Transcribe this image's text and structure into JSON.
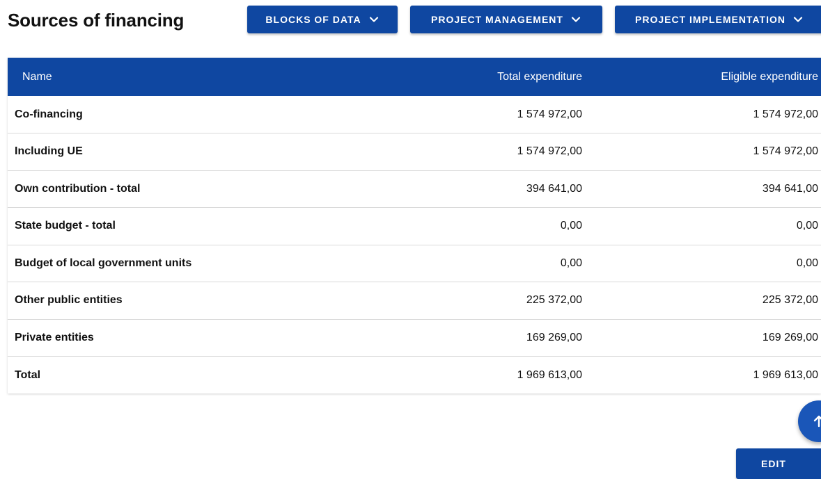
{
  "header": {
    "title": "Sources of financing",
    "nav_buttons": [
      {
        "label": "BLOCKS OF DATA",
        "icon": "chevron-down-icon"
      },
      {
        "label": "PROJECT MANAGEMENT",
        "icon": "chevron-down-icon"
      },
      {
        "label": "PROJECT IMPLEMENTATION",
        "icon": "chevron-down-icon"
      }
    ]
  },
  "table": {
    "columns": [
      "Name",
      "Total expenditure",
      "Eligible expenditure"
    ],
    "rows": [
      {
        "name": "Co-financing",
        "total": "1 574 972,00",
        "eligible": "1 574 972,00"
      },
      {
        "name": "Including UE",
        "total": "1 574 972,00",
        "eligible": "1 574 972,00"
      },
      {
        "name": "Own contribution - total",
        "total": "394 641,00",
        "eligible": "394 641,00"
      },
      {
        "name": "State budget - total",
        "total": "0,00",
        "eligible": "0,00"
      },
      {
        "name": "Budget of local government units",
        "total": "0,00",
        "eligible": "0,00"
      },
      {
        "name": "Other public entities",
        "total": "225 372,00",
        "eligible": "225 372,00"
      },
      {
        "name": "Private entities",
        "total": "169 269,00",
        "eligible": "169 269,00"
      },
      {
        "name": "Total",
        "total": "1 969 613,00",
        "eligible": "1 969 613,00"
      }
    ]
  },
  "actions": {
    "scroll_top_icon": "arrow-up-icon",
    "edit_label": "EDIT"
  },
  "colors": {
    "primary": "#0f47a1",
    "fab": "#1a56b8",
    "row_divider": "#d9d9d9"
  }
}
